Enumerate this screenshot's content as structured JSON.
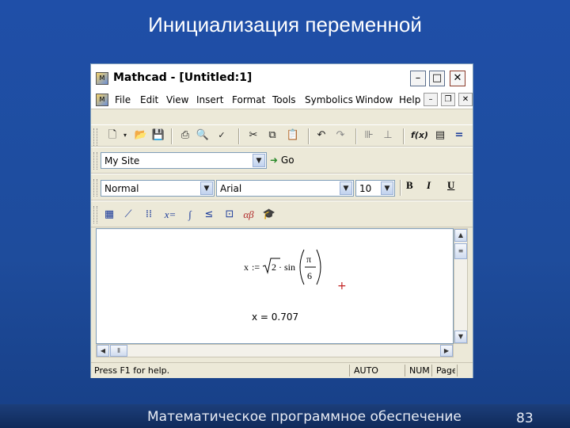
{
  "slide": {
    "title": "Инициализация переменной",
    "footer": "Математическое программное обеспечение",
    "page_number": "83"
  },
  "window": {
    "title": "Mathcad - [Untitled:1]",
    "app_icon": "mathcad-icon",
    "minimize_icon": "minimize-icon",
    "maximize_icon": "maximize-icon",
    "close_icon": "close-icon"
  },
  "menu": {
    "items": [
      "File",
      "Edit",
      "View",
      "Insert",
      "Format",
      "Tools",
      "Symbolics",
      "Window",
      "Help"
    ]
  },
  "standard_toolbar": {
    "icons": [
      "new-icon",
      "dropdown-icon",
      "open-icon",
      "save-icon",
      "print-icon",
      "print-preview-icon",
      "spell-check-icon",
      "cut-icon",
      "copy-icon",
      "paste-icon",
      "undo-icon",
      "redo-icon",
      "align-horizontal-icon",
      "align-vertical-icon",
      "function-icon",
      "unit-icon",
      "calculate-icon"
    ]
  },
  "web_toolbar": {
    "address_value": "My Site",
    "go_label": "Go"
  },
  "formatting_toolbar": {
    "style_value": "Normal",
    "font_value": "Arial",
    "size_value": "10",
    "bold_label": "B",
    "italic_label": "I",
    "underline_label": "U"
  },
  "math_toolbar": {
    "icons": [
      "calculator-icon",
      "graph-icon",
      "matrix-icon",
      "evaluation-icon",
      "calculus-icon",
      "boolean-icon",
      "programming-icon",
      "greek-icon",
      "symbolic-icon"
    ],
    "evaluation_label": "x="
  },
  "document": {
    "definition": {
      "var": "x",
      "assign": ":=",
      "radicand": "2",
      "dot": "·",
      "func": "sin",
      "numerator": "π",
      "denominator": "6"
    },
    "crosshair": "+",
    "result": "x = 0.707"
  },
  "status": {
    "help_text": "Press F1 for help.",
    "mode": "AUTO",
    "num": "NUM",
    "page": "Page"
  }
}
